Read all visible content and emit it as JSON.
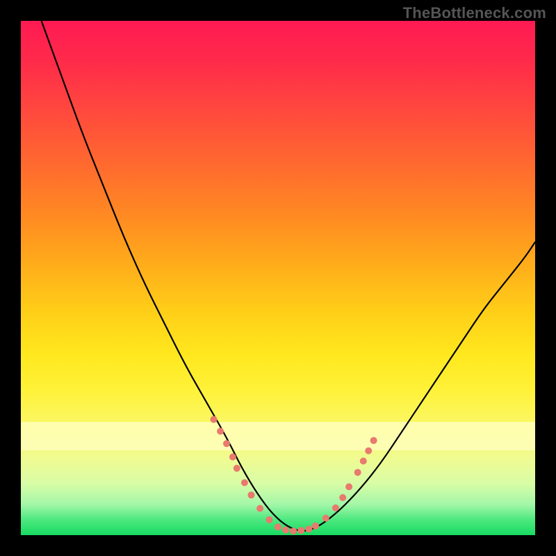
{
  "watermark": "TheBottleneck.com",
  "chart_data": {
    "type": "line",
    "title": "",
    "xlabel": "",
    "ylabel": "",
    "xlim": [
      0,
      100
    ],
    "ylim": [
      0,
      100
    ],
    "series": [
      {
        "name": "bottleneck-curve",
        "x": [
          4,
          8,
          12,
          16,
          20,
          24,
          28,
          32,
          36,
          40,
          43,
          46,
          49,
          52,
          55,
          58,
          62,
          66,
          70,
          74,
          78,
          82,
          86,
          90,
          94,
          98,
          100
        ],
        "y": [
          100,
          89,
          78,
          68,
          58,
          49,
          41,
          33,
          26,
          19,
          13,
          8,
          4,
          1.5,
          0.6,
          1.7,
          4.8,
          9,
          14,
          20,
          26,
          32,
          38,
          44,
          49,
          54,
          57
        ]
      }
    ],
    "markers": {
      "name": "highlighted-points",
      "color": "#e87a6e",
      "points": [
        {
          "x": 37.5,
          "y": 22.5,
          "r": 5
        },
        {
          "x": 38.8,
          "y": 20.2,
          "r": 5
        },
        {
          "x": 40.0,
          "y": 17.8,
          "r": 5
        },
        {
          "x": 41.2,
          "y": 15.2,
          "r": 5
        },
        {
          "x": 42.0,
          "y": 13.0,
          "r": 5
        },
        {
          "x": 43.5,
          "y": 10.2,
          "r": 5
        },
        {
          "x": 44.8,
          "y": 7.8,
          "r": 5
        },
        {
          "x": 46.5,
          "y": 5.2,
          "r": 5
        },
        {
          "x": 48.3,
          "y": 3.0,
          "r": 5
        },
        {
          "x": 50.0,
          "y": 1.6,
          "r": 5
        },
        {
          "x": 51.5,
          "y": 1.0,
          "r": 5
        },
        {
          "x": 53.0,
          "y": 0.8,
          "r": 5
        },
        {
          "x": 54.5,
          "y": 0.9,
          "r": 5
        },
        {
          "x": 56.0,
          "y": 1.2,
          "r": 5
        },
        {
          "x": 57.3,
          "y": 1.8,
          "r": 5
        },
        {
          "x": 59.3,
          "y": 3.3,
          "r": 5
        },
        {
          "x": 61.2,
          "y": 5.3,
          "r": 5
        },
        {
          "x": 62.6,
          "y": 7.3,
          "r": 5
        },
        {
          "x": 63.8,
          "y": 9.4,
          "r": 5
        },
        {
          "x": 65.5,
          "y": 12.2,
          "r": 5
        },
        {
          "x": 66.6,
          "y": 14.4,
          "r": 5
        },
        {
          "x": 67.6,
          "y": 16.4,
          "r": 5
        },
        {
          "x": 68.6,
          "y": 18.4,
          "r": 5
        }
      ]
    },
    "band": {
      "y_top": 22,
      "y_bottom": 16.5,
      "color": "#ffffc0"
    },
    "gradient_stops": [
      {
        "pos": 0,
        "color": "#ff1a53"
      },
      {
        "pos": 50,
        "color": "#ffd018"
      },
      {
        "pos": 100,
        "color": "#17db62"
      }
    ]
  }
}
